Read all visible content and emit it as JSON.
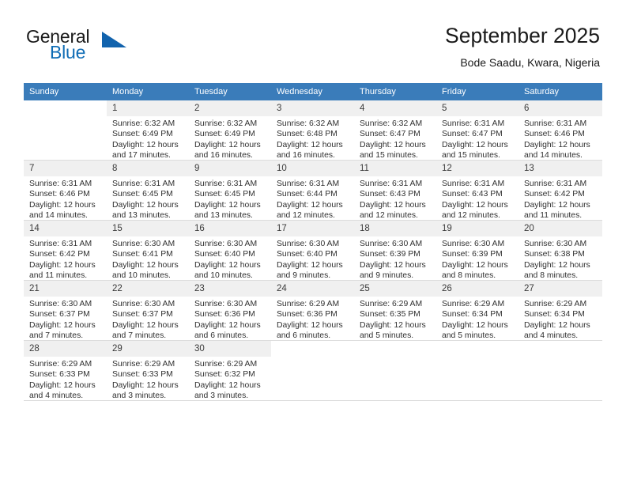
{
  "brand": {
    "name_part1": "General",
    "name_part2": "Blue",
    "accent_color": "#1263ad",
    "triangle_icon": "brand-triangle-icon"
  },
  "header": {
    "title": "September 2025",
    "location": "Bode Saadu, Kwara, Nigeria"
  },
  "calendar": {
    "header_bg": "#3a7cba",
    "daynum_bg": "#f0f0f0",
    "weekdays": [
      "Sunday",
      "Monday",
      "Tuesday",
      "Wednesday",
      "Thursday",
      "Friday",
      "Saturday"
    ],
    "weeks": [
      [
        {
          "day": "",
          "sunrise": "",
          "sunset": "",
          "daylight_line1": "",
          "daylight_line2": ""
        },
        {
          "day": "1",
          "sunrise": "Sunrise: 6:32 AM",
          "sunset": "Sunset: 6:49 PM",
          "daylight_line1": "Daylight: 12 hours",
          "daylight_line2": "and 17 minutes."
        },
        {
          "day": "2",
          "sunrise": "Sunrise: 6:32 AM",
          "sunset": "Sunset: 6:49 PM",
          "daylight_line1": "Daylight: 12 hours",
          "daylight_line2": "and 16 minutes."
        },
        {
          "day": "3",
          "sunrise": "Sunrise: 6:32 AM",
          "sunset": "Sunset: 6:48 PM",
          "daylight_line1": "Daylight: 12 hours",
          "daylight_line2": "and 16 minutes."
        },
        {
          "day": "4",
          "sunrise": "Sunrise: 6:32 AM",
          "sunset": "Sunset: 6:47 PM",
          "daylight_line1": "Daylight: 12 hours",
          "daylight_line2": "and 15 minutes."
        },
        {
          "day": "5",
          "sunrise": "Sunrise: 6:31 AM",
          "sunset": "Sunset: 6:47 PM",
          "daylight_line1": "Daylight: 12 hours",
          "daylight_line2": "and 15 minutes."
        },
        {
          "day": "6",
          "sunrise": "Sunrise: 6:31 AM",
          "sunset": "Sunset: 6:46 PM",
          "daylight_line1": "Daylight: 12 hours",
          "daylight_line2": "and 14 minutes."
        }
      ],
      [
        {
          "day": "7",
          "sunrise": "Sunrise: 6:31 AM",
          "sunset": "Sunset: 6:46 PM",
          "daylight_line1": "Daylight: 12 hours",
          "daylight_line2": "and 14 minutes."
        },
        {
          "day": "8",
          "sunrise": "Sunrise: 6:31 AM",
          "sunset": "Sunset: 6:45 PM",
          "daylight_line1": "Daylight: 12 hours",
          "daylight_line2": "and 13 minutes."
        },
        {
          "day": "9",
          "sunrise": "Sunrise: 6:31 AM",
          "sunset": "Sunset: 6:45 PM",
          "daylight_line1": "Daylight: 12 hours",
          "daylight_line2": "and 13 minutes."
        },
        {
          "day": "10",
          "sunrise": "Sunrise: 6:31 AM",
          "sunset": "Sunset: 6:44 PM",
          "daylight_line1": "Daylight: 12 hours",
          "daylight_line2": "and 12 minutes."
        },
        {
          "day": "11",
          "sunrise": "Sunrise: 6:31 AM",
          "sunset": "Sunset: 6:43 PM",
          "daylight_line1": "Daylight: 12 hours",
          "daylight_line2": "and 12 minutes."
        },
        {
          "day": "12",
          "sunrise": "Sunrise: 6:31 AM",
          "sunset": "Sunset: 6:43 PM",
          "daylight_line1": "Daylight: 12 hours",
          "daylight_line2": "and 12 minutes."
        },
        {
          "day": "13",
          "sunrise": "Sunrise: 6:31 AM",
          "sunset": "Sunset: 6:42 PM",
          "daylight_line1": "Daylight: 12 hours",
          "daylight_line2": "and 11 minutes."
        }
      ],
      [
        {
          "day": "14",
          "sunrise": "Sunrise: 6:31 AM",
          "sunset": "Sunset: 6:42 PM",
          "daylight_line1": "Daylight: 12 hours",
          "daylight_line2": "and 11 minutes."
        },
        {
          "day": "15",
          "sunrise": "Sunrise: 6:30 AM",
          "sunset": "Sunset: 6:41 PM",
          "daylight_line1": "Daylight: 12 hours",
          "daylight_line2": "and 10 minutes."
        },
        {
          "day": "16",
          "sunrise": "Sunrise: 6:30 AM",
          "sunset": "Sunset: 6:40 PM",
          "daylight_line1": "Daylight: 12 hours",
          "daylight_line2": "and 10 minutes."
        },
        {
          "day": "17",
          "sunrise": "Sunrise: 6:30 AM",
          "sunset": "Sunset: 6:40 PM",
          "daylight_line1": "Daylight: 12 hours",
          "daylight_line2": "and 9 minutes."
        },
        {
          "day": "18",
          "sunrise": "Sunrise: 6:30 AM",
          "sunset": "Sunset: 6:39 PM",
          "daylight_line1": "Daylight: 12 hours",
          "daylight_line2": "and 9 minutes."
        },
        {
          "day": "19",
          "sunrise": "Sunrise: 6:30 AM",
          "sunset": "Sunset: 6:39 PM",
          "daylight_line1": "Daylight: 12 hours",
          "daylight_line2": "and 8 minutes."
        },
        {
          "day": "20",
          "sunrise": "Sunrise: 6:30 AM",
          "sunset": "Sunset: 6:38 PM",
          "daylight_line1": "Daylight: 12 hours",
          "daylight_line2": "and 8 minutes."
        }
      ],
      [
        {
          "day": "21",
          "sunrise": "Sunrise: 6:30 AM",
          "sunset": "Sunset: 6:37 PM",
          "daylight_line1": "Daylight: 12 hours",
          "daylight_line2": "and 7 minutes."
        },
        {
          "day": "22",
          "sunrise": "Sunrise: 6:30 AM",
          "sunset": "Sunset: 6:37 PM",
          "daylight_line1": "Daylight: 12 hours",
          "daylight_line2": "and 7 minutes."
        },
        {
          "day": "23",
          "sunrise": "Sunrise: 6:30 AM",
          "sunset": "Sunset: 6:36 PM",
          "daylight_line1": "Daylight: 12 hours",
          "daylight_line2": "and 6 minutes."
        },
        {
          "day": "24",
          "sunrise": "Sunrise: 6:29 AM",
          "sunset": "Sunset: 6:36 PM",
          "daylight_line1": "Daylight: 12 hours",
          "daylight_line2": "and 6 minutes."
        },
        {
          "day": "25",
          "sunrise": "Sunrise: 6:29 AM",
          "sunset": "Sunset: 6:35 PM",
          "daylight_line1": "Daylight: 12 hours",
          "daylight_line2": "and 5 minutes."
        },
        {
          "day": "26",
          "sunrise": "Sunrise: 6:29 AM",
          "sunset": "Sunset: 6:34 PM",
          "daylight_line1": "Daylight: 12 hours",
          "daylight_line2": "and 5 minutes."
        },
        {
          "day": "27",
          "sunrise": "Sunrise: 6:29 AM",
          "sunset": "Sunset: 6:34 PM",
          "daylight_line1": "Daylight: 12 hours",
          "daylight_line2": "and 4 minutes."
        }
      ],
      [
        {
          "day": "28",
          "sunrise": "Sunrise: 6:29 AM",
          "sunset": "Sunset: 6:33 PM",
          "daylight_line1": "Daylight: 12 hours",
          "daylight_line2": "and 4 minutes."
        },
        {
          "day": "29",
          "sunrise": "Sunrise: 6:29 AM",
          "sunset": "Sunset: 6:33 PM",
          "daylight_line1": "Daylight: 12 hours",
          "daylight_line2": "and 3 minutes."
        },
        {
          "day": "30",
          "sunrise": "Sunrise: 6:29 AM",
          "sunset": "Sunset: 6:32 PM",
          "daylight_line1": "Daylight: 12 hours",
          "daylight_line2": "and 3 minutes."
        },
        {
          "day": "",
          "sunrise": "",
          "sunset": "",
          "daylight_line1": "",
          "daylight_line2": ""
        },
        {
          "day": "",
          "sunrise": "",
          "sunset": "",
          "daylight_line1": "",
          "daylight_line2": ""
        },
        {
          "day": "",
          "sunrise": "",
          "sunset": "",
          "daylight_line1": "",
          "daylight_line2": ""
        },
        {
          "day": "",
          "sunrise": "",
          "sunset": "",
          "daylight_line1": "",
          "daylight_line2": ""
        }
      ]
    ]
  }
}
